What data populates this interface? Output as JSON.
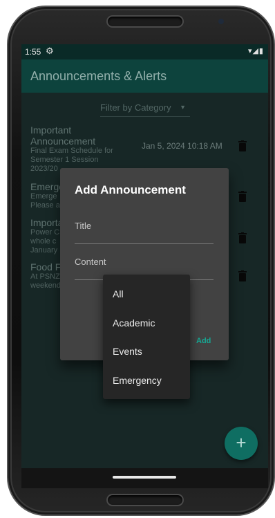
{
  "status_bar": {
    "time": "1:55",
    "settings_glyph": "⚙",
    "signal_icons": "▾◢▮"
  },
  "app_bar": {
    "title": "Announcements & Alerts"
  },
  "filter": {
    "label": "Filter by Category",
    "arrow": "▼"
  },
  "announcements": [
    {
      "title_line1": "Important",
      "title_line2": "Announcement",
      "body_line1": "Final Exam Schedule for",
      "body_line2": "Semester 1 Session",
      "body_line3": "2023/20",
      "date": "Jan 5, 2024 10:18 AM"
    },
    {
      "title": "Emerge",
      "body_line1": "Emerge",
      "body_line2": "Please a"
    },
    {
      "title": "Importa",
      "body_line1": "Power C",
      "body_line2": "whole c",
      "body_line3": "January"
    },
    {
      "title": "Food F",
      "body_line1": "At PSNZ",
      "body_line2": "weekend"
    }
  ],
  "dialog": {
    "title": "Add Announcement",
    "title_field": "Title",
    "content_field": "Content",
    "add_button": "Add"
  },
  "dropdown": {
    "options": [
      "All",
      "Academic",
      "Events",
      "Emergency"
    ]
  },
  "fab": {
    "label": "+"
  },
  "colors": {
    "app_bar": "#0f4d46",
    "status_bar": "#0c302d",
    "background": "#1b2d2c",
    "accent": "#16a894",
    "dialog": "#424242",
    "menu": "#262626"
  },
  "icons": {
    "delete": "trash-icon",
    "add": "plus-icon",
    "settings": "gear-icon"
  }
}
